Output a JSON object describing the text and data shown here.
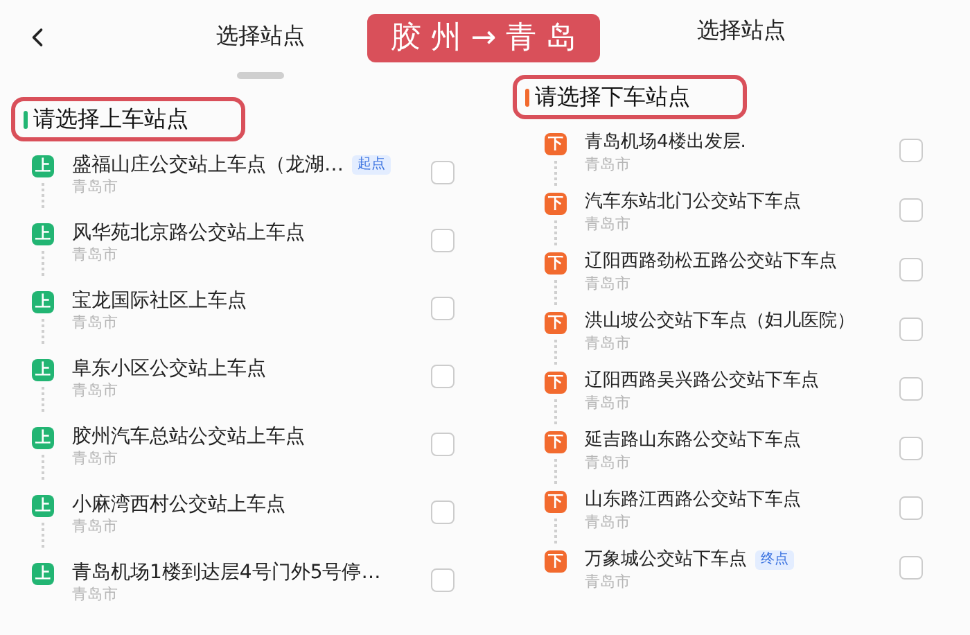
{
  "banner": "胶 州 → 青 岛",
  "panels": [
    {
      "title": "选择站点",
      "back": true,
      "handle": true,
      "section": "请选择上车站点",
      "kind": "board",
      "stops": [
        {
          "badge": "上",
          "name": "盛福山庄公交站上车点（龙湖…",
          "tag": "起点",
          "city": "青岛市",
          "checked": false
        },
        {
          "badge": "上",
          "name": "风华苑北京路公交站上车点",
          "city": "青岛市",
          "checked": false
        },
        {
          "badge": "上",
          "name": "宝龙国际社区上车点",
          "city": "青岛市",
          "checked": false
        },
        {
          "badge": "上",
          "name": "阜东小区公交站上车点",
          "city": "青岛市",
          "checked": false
        },
        {
          "badge": "上",
          "name": "胶州汽车总站公交站上车点",
          "city": "青岛市",
          "checked": false
        },
        {
          "badge": "上",
          "name": "小麻湾西村公交站上车点",
          "city": "青岛市",
          "checked": false
        },
        {
          "badge": "上",
          "name": "青岛机场1楼到达层4号门外5号停…",
          "city": "青岛市",
          "checked": false
        }
      ]
    },
    {
      "title": "选择站点",
      "back": false,
      "handle": false,
      "section": "请选择下车站点",
      "kind": "alight",
      "stops": [
        {
          "badge": "下",
          "name": "青岛机场4楼出发层.",
          "city": "青岛市",
          "checked": false
        },
        {
          "badge": "下",
          "name": "汽车东站北门公交站下车点",
          "city": "青岛市",
          "checked": false
        },
        {
          "badge": "下",
          "name": "辽阳西路劲松五路公交站下车点",
          "city": "青岛市",
          "checked": false
        },
        {
          "badge": "下",
          "name": "洪山坡公交站下车点（妇儿医院）",
          "city": "青岛市",
          "checked": false
        },
        {
          "badge": "下",
          "name": "辽阳西路吴兴路公交站下车点",
          "city": "青岛市",
          "checked": false
        },
        {
          "badge": "下",
          "name": "延吉路山东路公交站下车点",
          "city": "青岛市",
          "checked": false
        },
        {
          "badge": "下",
          "name": "山东路江西路公交站下车点",
          "city": "青岛市",
          "checked": false
        },
        {
          "badge": "下",
          "name": "万象城公交站下车点",
          "tag": "终点",
          "city": "青岛市",
          "checked": false
        }
      ]
    }
  ]
}
